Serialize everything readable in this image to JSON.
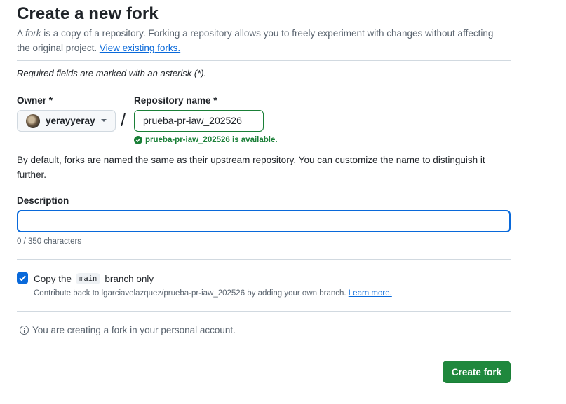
{
  "page": {
    "title": "Create a new fork",
    "intro_prefix": "A ",
    "intro_em": "fork",
    "intro_text": " is a copy of a repository. Forking a repository allows you to freely experiment with changes without affecting the original project. ",
    "intro_link": "View existing forks.",
    "required_note": "Required fields are marked with an asterisk (*)."
  },
  "owner": {
    "label": "Owner *",
    "value": "yerayyeray"
  },
  "repo": {
    "label": "Repository name *",
    "value": "prueba-pr-iaw_202526",
    "availability": "prueba-pr-iaw_202526 is available."
  },
  "default_note": "By default, forks are named the same as their upstream repository. You can customize the name to distinguish it further.",
  "description": {
    "label": "Description",
    "value": "",
    "counter": "0 / 350 characters"
  },
  "copy_branch": {
    "checked": true,
    "label_prefix": "Copy the",
    "branch": "main",
    "label_suffix": "branch only",
    "contribute_text": "Contribute back to lgarciavelazquez/prueba-pr-iaw_202526 by adding your own branch. ",
    "learn_more": "Learn more."
  },
  "info": {
    "text": "You are creating a fork in your personal account."
  },
  "actions": {
    "create_label": "Create fork"
  },
  "colors": {
    "accent": "#0969da",
    "success": "#1a7f37",
    "primary_button": "#1f883d"
  }
}
